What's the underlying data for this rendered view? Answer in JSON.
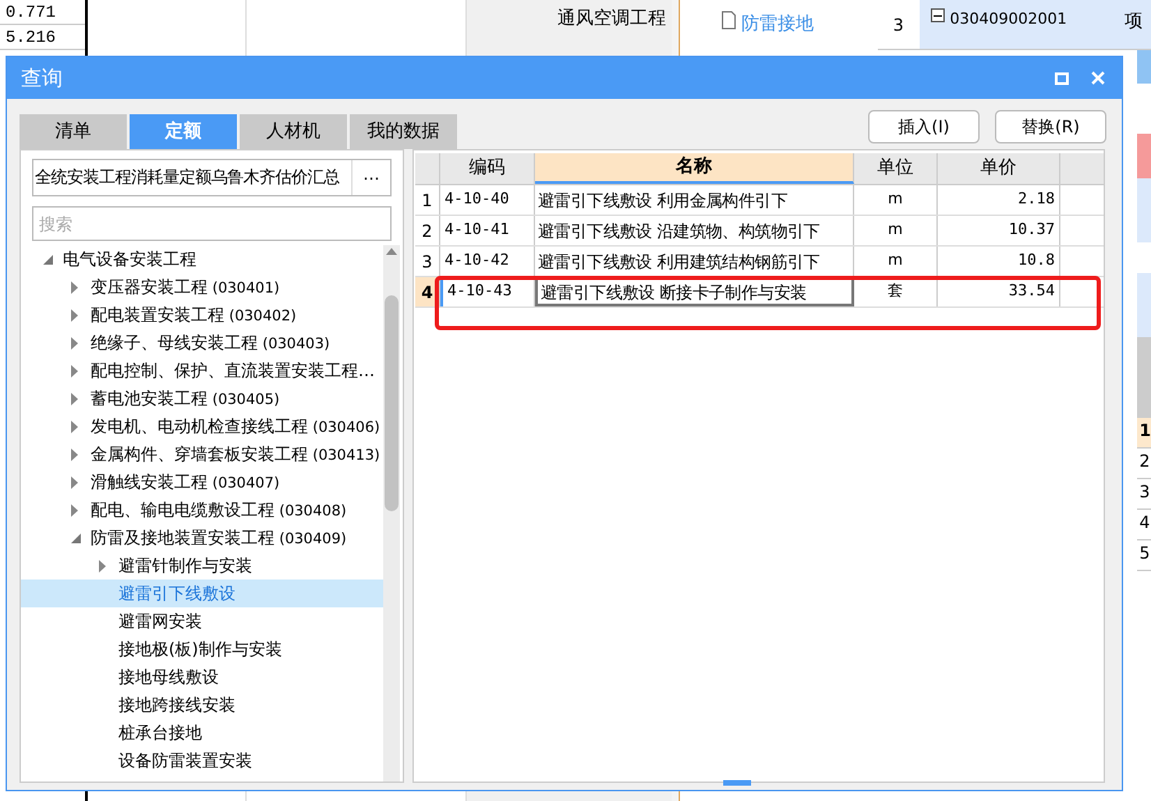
{
  "background": {
    "values": [
      "0.771",
      "5.216"
    ],
    "categories": [
      "通风空调工程"
    ],
    "tree_item": "防雷接地",
    "row": {
      "number": "3",
      "code": "030409002001",
      "unit": "项"
    },
    "row_numbers": [
      "1",
      "2",
      "3",
      "4",
      "5"
    ]
  },
  "dialog": {
    "title": "查询",
    "tabs": [
      {
        "label": "清单",
        "selected": false
      },
      {
        "label": "定额",
        "selected": true
      },
      {
        "label": "人材机",
        "selected": false
      },
      {
        "label": "我的数据",
        "selected": false
      }
    ],
    "buttons": [
      "插入(I)",
      "替换(R)"
    ],
    "library": "全统安装工程消耗量定额乌鲁木齐估价汇总",
    "library_button": "⋯",
    "search": {
      "placeholder": "搜索"
    },
    "tree": [
      {
        "label": "电气设备安装工程",
        "expanded": true,
        "selected": false,
        "children": [
          {
            "label": "变压器安装工程",
            "code": "(030401)",
            "expanded": false,
            "selected": false
          },
          {
            "label": "配电装置安装工程",
            "code": "(030402)",
            "expanded": false,
            "selected": false
          },
          {
            "label": "绝缘子、母线安装工程",
            "code": "(030403)",
            "expanded": false,
            "selected": false
          },
          {
            "label": "配电控制、保护、直流装置安装工程…",
            "expanded": false,
            "selected": false
          },
          {
            "label": "蓄电池安装工程",
            "code": "(030405)",
            "expanded": false,
            "selected": false
          },
          {
            "label": "发电机、电动机检查接线工程",
            "code": "(030406)",
            "expanded": false,
            "selected": false
          },
          {
            "label": "金属构件、穿墙套板安装工程",
            "code": "(030413)",
            "expanded": false,
            "selected": false
          },
          {
            "label": "滑触线安装工程",
            "code": "(030407)",
            "expanded": false,
            "selected": false
          },
          {
            "label": "配电、输电电缆敷设工程",
            "code": "(030408)",
            "expanded": false,
            "selected": false
          },
          {
            "label": "防雷及接地装置安装工程",
            "code": "(030409)",
            "expanded": true,
            "selected": false,
            "children": [
              {
                "label": "避雷针制作与安装",
                "expanded": false,
                "selected": false
              },
              {
                "label": "避雷引下线敷设",
                "selected": true
              },
              {
                "label": "避雷网安装",
                "selected": false
              },
              {
                "label": "接地极(板)制作与安装",
                "selected": false
              },
              {
                "label": "接地母线敷设",
                "selected": false
              },
              {
                "label": "接地跨接线安装",
                "selected": false
              },
              {
                "label": "桩承台接地",
                "selected": false
              },
              {
                "label": "设备防雷装置安装",
                "selected": false
              }
            ]
          }
        ]
      }
    ],
    "table": {
      "columns": [
        "编码",
        "名称",
        "单位",
        "单价"
      ],
      "rows": [
        {
          "index": "1",
          "code": "4-10-40",
          "name": "避雷引下线敷设 利用金属构件引下",
          "unit": "m",
          "price": "2.18",
          "selected": false,
          "highlighted": false
        },
        {
          "index": "2",
          "code": "4-10-41",
          "name": "避雷引下线敷设 沿建筑物、构筑物引下",
          "unit": "m",
          "price": "10.37",
          "selected": false,
          "highlighted": false
        },
        {
          "index": "3",
          "code": "4-10-42",
          "name": "避雷引下线敷设 利用建筑结构钢筋引下",
          "unit": "m",
          "price": "10.8",
          "selected": false,
          "highlighted": false
        },
        {
          "index": "4",
          "code": "4-10-43",
          "name": "避雷引下线敷设 断接卡子制作与安装",
          "unit": "套",
          "price": "33.54",
          "selected": true,
          "highlighted": true
        }
      ]
    }
  }
}
